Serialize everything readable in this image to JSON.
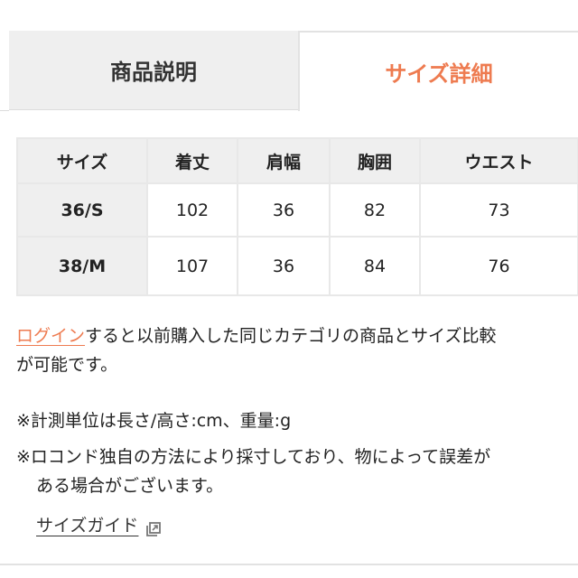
{
  "tabs": [
    {
      "label": "商品説明",
      "active": false
    },
    {
      "label": "サイズ詳細",
      "active": true
    }
  ],
  "colors": {
    "accent": "#ee7b50",
    "tab_inactive_bg": "#efefef",
    "table_header_bg": "#efefef",
    "border": "#e8e8e8"
  },
  "size_table": {
    "headers": [
      "サイズ",
      "着丈",
      "肩幅",
      "胸囲",
      "ウエスト"
    ],
    "rows": [
      [
        "36/S",
        "102",
        "36",
        "82",
        "73"
      ],
      [
        "38/M",
        "107",
        "36",
        "84",
        "76"
      ]
    ]
  },
  "login_notice": {
    "link_label": "ログイン",
    "text_line1": "すると以前購入した同じカテゴリの商品とサイズ比較",
    "text_line2": "が可能です。"
  },
  "notes": {
    "unit": "※計測単位は長さ/高さ:cm、重量:g",
    "method_line1": "※ロコンド独自の方法により採寸しており、物によって誤差が",
    "method_line2": "ある場合がございます。"
  },
  "size_guide": {
    "label": "サイズガイド",
    "icon": "external-link-icon"
  }
}
